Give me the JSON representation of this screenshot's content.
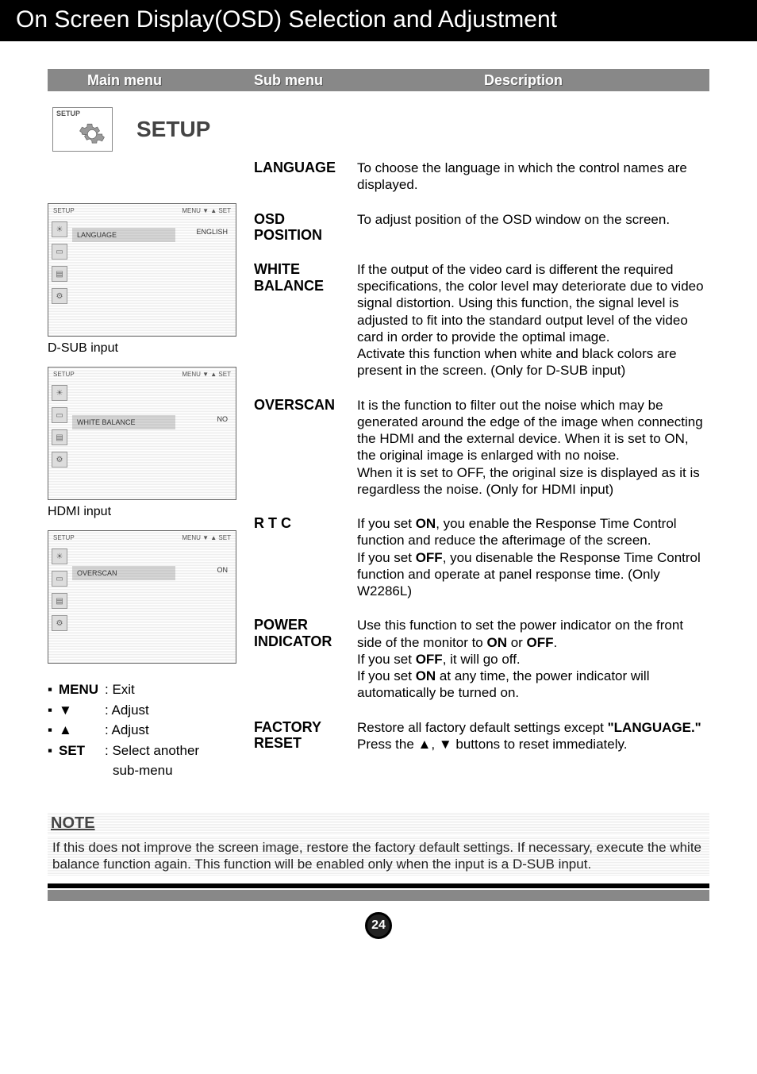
{
  "title": "On Screen Display(OSD) Selection and Adjustment",
  "headers": {
    "c1": "Main menu",
    "c2": "Sub menu",
    "c3": "Description"
  },
  "setup": {
    "iconLabel": "SETUP",
    "title": "SETUP"
  },
  "panels": {
    "p1": {
      "top": "SETUP",
      "hint": "MENU    ▼    ▲    SET",
      "row": "LANGUAGE",
      "val": "ENGLISH"
    },
    "caption1": "D-SUB input",
    "p2": {
      "top": "SETUP",
      "hint": "MENU    ▼    ▲    SET",
      "row": "WHITE BALANCE",
      "val": "NO"
    },
    "caption2": "HDMI input",
    "p3": {
      "top": "SETUP",
      "hint": "MENU    ▼    ▲    SET",
      "row": "OVERSCAN",
      "val": "ON"
    }
  },
  "items": {
    "language": {
      "label": "LANGUAGE",
      "desc": "To choose the language in which the control names are displayed."
    },
    "osdpos": {
      "label1": "OSD",
      "label2": "POSITION",
      "desc": "To adjust position of the OSD window on the screen."
    },
    "white": {
      "label1": "WHITE",
      "label2": "BALANCE",
      "desc": "If the output of the video card is different the required specifications, the color level may deteriorate due to video signal distortion. Using this function, the signal level is adjusted to fit into the standard output level of the video card in order to provide the optimal image.\nActivate this function when white and black colors are present in the screen. (Only for D-SUB input)"
    },
    "overscan": {
      "label": "OVERSCAN",
      "desc": "It is the function to filter out the noise which may be generated around the edge of the image when connecting the HDMI and the external device. When it is set to ON, the original image is enlarged with no noise.\nWhen it is set to OFF, the original size is displayed as it is regardless the noise. (Only for HDMI input)"
    },
    "rtc": {
      "label": "R T C",
      "p1a": "If you set ",
      "p1b": "ON",
      "p1c": ", you enable the Response Time Control function and reduce the afterimage of the screen.",
      "p2a": "If you set ",
      "p2b": "OFF",
      "p2c": ", you disenable the Response Time Control function and operate at panel response time. (Only W2286L)"
    },
    "power": {
      "label1": "POWER",
      "label2": "INDICATOR",
      "p1a": "Use this function to set the power indicator on the front side of the monitor to ",
      "p1b": "ON",
      "p1c": " or ",
      "p1d": "OFF",
      "p1e": ".",
      "p2a": "If you set ",
      "p2b": "OFF",
      "p2c": ", it will go off.",
      "p3a": "If you set ",
      "p3b": "ON",
      "p3c": " at any time, the power indicator will automatically be turned on."
    },
    "factory": {
      "label1": "FACTORY",
      "label2": "RESET",
      "p1a": "Restore all factory default settings except ",
      "p1b": "\"LANGUAGE.\"",
      "p2a": "Press the ",
      "p2b": "▲",
      "p2c": ", ",
      "p2d": "▼",
      "p2e": " buttons to reset immediately."
    }
  },
  "controls": {
    "r1k": "MENU",
    "r1v": ": Exit",
    "r2k": "▼",
    "r2v": ": Adjust",
    "r3k": "▲",
    "r3v": ": Adjust",
    "r4k": "SET",
    "r4v": ": Select another",
    "r4v2": "sub-menu"
  },
  "note": {
    "title": "NOTE",
    "body": "If this does not improve the screen image, restore the factory default settings. If necessary, execute the white balance function again. This function will be enabled only when the input is a D-SUB input."
  },
  "pageNumber": "24"
}
